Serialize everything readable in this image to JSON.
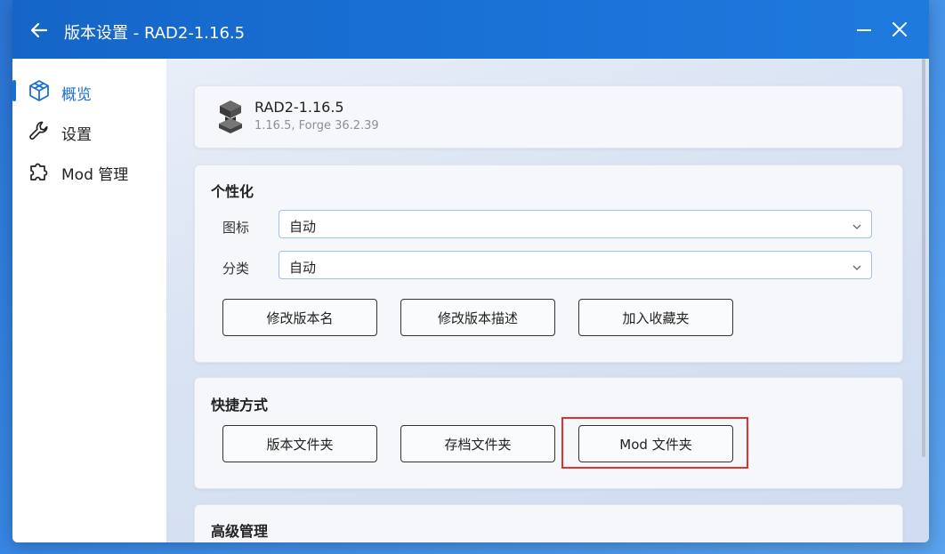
{
  "window": {
    "title": "版本设置 - RAD2-1.16.5"
  },
  "sidebar": {
    "items": [
      {
        "label": "概览",
        "icon": "cube-icon",
        "active": true
      },
      {
        "label": "设置",
        "icon": "wrench-icon",
        "active": false
      },
      {
        "label": "Mod 管理",
        "icon": "puzzle-icon",
        "active": false
      }
    ]
  },
  "version": {
    "name": "RAD2-1.16.5",
    "detail": "1.16.5, Forge 36.2.39",
    "icon": "anvil-icon"
  },
  "personalize": {
    "title": "个性化",
    "icon_label": "图标",
    "icon_value": "自动",
    "category_label": "分类",
    "category_value": "自动",
    "buttons": [
      "修改版本名",
      "修改版本描述",
      "加入收藏夹"
    ]
  },
  "shortcuts": {
    "title": "快捷方式",
    "buttons": [
      "版本文件夹",
      "存档文件夹",
      "Mod 文件夹"
    ]
  },
  "advanced": {
    "title": "高级管理"
  },
  "colors": {
    "accent": "#1a6fd6",
    "titlebar": "#1a73d8",
    "highlight": "#e03030"
  }
}
